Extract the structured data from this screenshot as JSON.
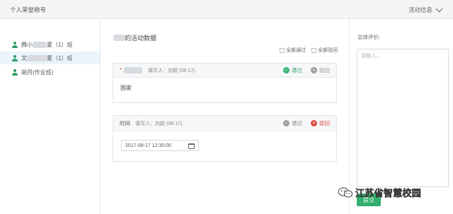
{
  "header": {
    "title": "个人荣誉称号",
    "right_label": "活动信息"
  },
  "sidebar": {
    "items": [
      {
        "prefix": "腾小",
        "suffix": "夏（1）班",
        "active": false
      },
      {
        "prefix": "文",
        "suffix": "夏（1）班",
        "active": true
      },
      {
        "prefix": "",
        "suffix": "胡月(作业班)",
        "active": false
      }
    ]
  },
  "main": {
    "title_suffix": "的活动数据",
    "approve_all": "全部通过",
    "reject_all": "全部驳回"
  },
  "cards": [
    {
      "required_mark": "*",
      "label": "",
      "author": "填写人：刘超 (08-17)",
      "pass_label": "通过",
      "reject_label": "驳回",
      "status": "pass",
      "body_text": "国家"
    },
    {
      "label": "时间",
      "author": "填写人：刘超 (08-17)",
      "pass_label": "通过",
      "reject_label": "驳回",
      "status": "reject",
      "date_value": "2017-08-17 12:30:00"
    }
  ],
  "right": {
    "eval_label": "总体评价:",
    "placeholder": "请输入...",
    "submit_label": "提交"
  },
  "watermark": {
    "text": "江苏省智慧校园"
  },
  "colors": {
    "accent_green": "#2faf6b",
    "reject_red": "#e24a3b",
    "active_bg": "#eaf4fb"
  }
}
